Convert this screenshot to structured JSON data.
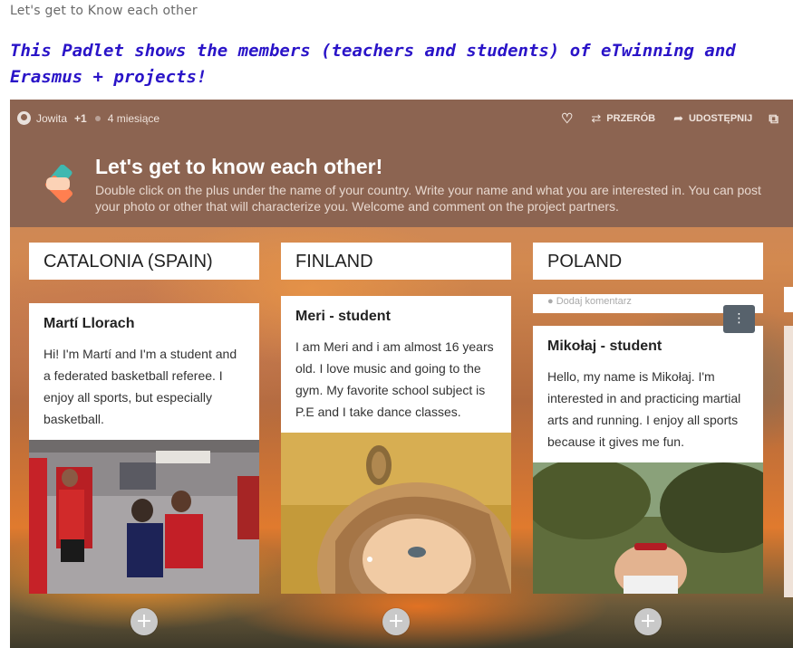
{
  "page": {
    "title": "Let's get to  Know each other",
    "headline": "This Padlet shows the members (teachers and students) of eTwinning and Erasmus + projects!"
  },
  "padlet": {
    "author": "Jowita",
    "contributors": "+1",
    "age": "4 miesiące",
    "actions": {
      "remake": "PRZERÓB",
      "share": "UDOSTĘPNIJ"
    },
    "title": "Let's get to know each other!",
    "description": "Double click on the plus under the name of your country. Write your name and what you are interested in. You can post your photo or other that will characterize you. Welcome and comment on the project partners.",
    "columns": [
      {
        "name": "CATALONIA (SPAIN)",
        "post_title": "Martí Llorach",
        "post_body": "Hi! I'm Martí and I'm a student and a federated basketball referee. I enjoy all sports, but especially basketball.",
        "add_label": "+"
      },
      {
        "name": "FINLAND",
        "post_title": "Meri - student",
        "post_body": "I am Meri and i am almost 16 years old. I love music and going to the gym. My favorite school subject is P.E and I take dance classes.",
        "add_label": "+"
      },
      {
        "name": "POLAND",
        "comment_placeholder": "Dodaj komentarz",
        "post_title": "Mikołaj - student",
        "post_body": "Hello, my name is Mikołaj. I'm interested in and practicing martial arts and running. I enjoy all sports because it gives me fun.",
        "add_label": "+"
      }
    ]
  },
  "icons": {
    "heart": "heart-icon",
    "remake": "remake-icon",
    "share": "share-icon",
    "external": "external-link-icon",
    "menu": "kebab-menu-icon",
    "comment": "comment-icon"
  },
  "colors": {
    "header": "#8c6451",
    "headline": "#2a14c8",
    "kebab": "#57626c"
  }
}
